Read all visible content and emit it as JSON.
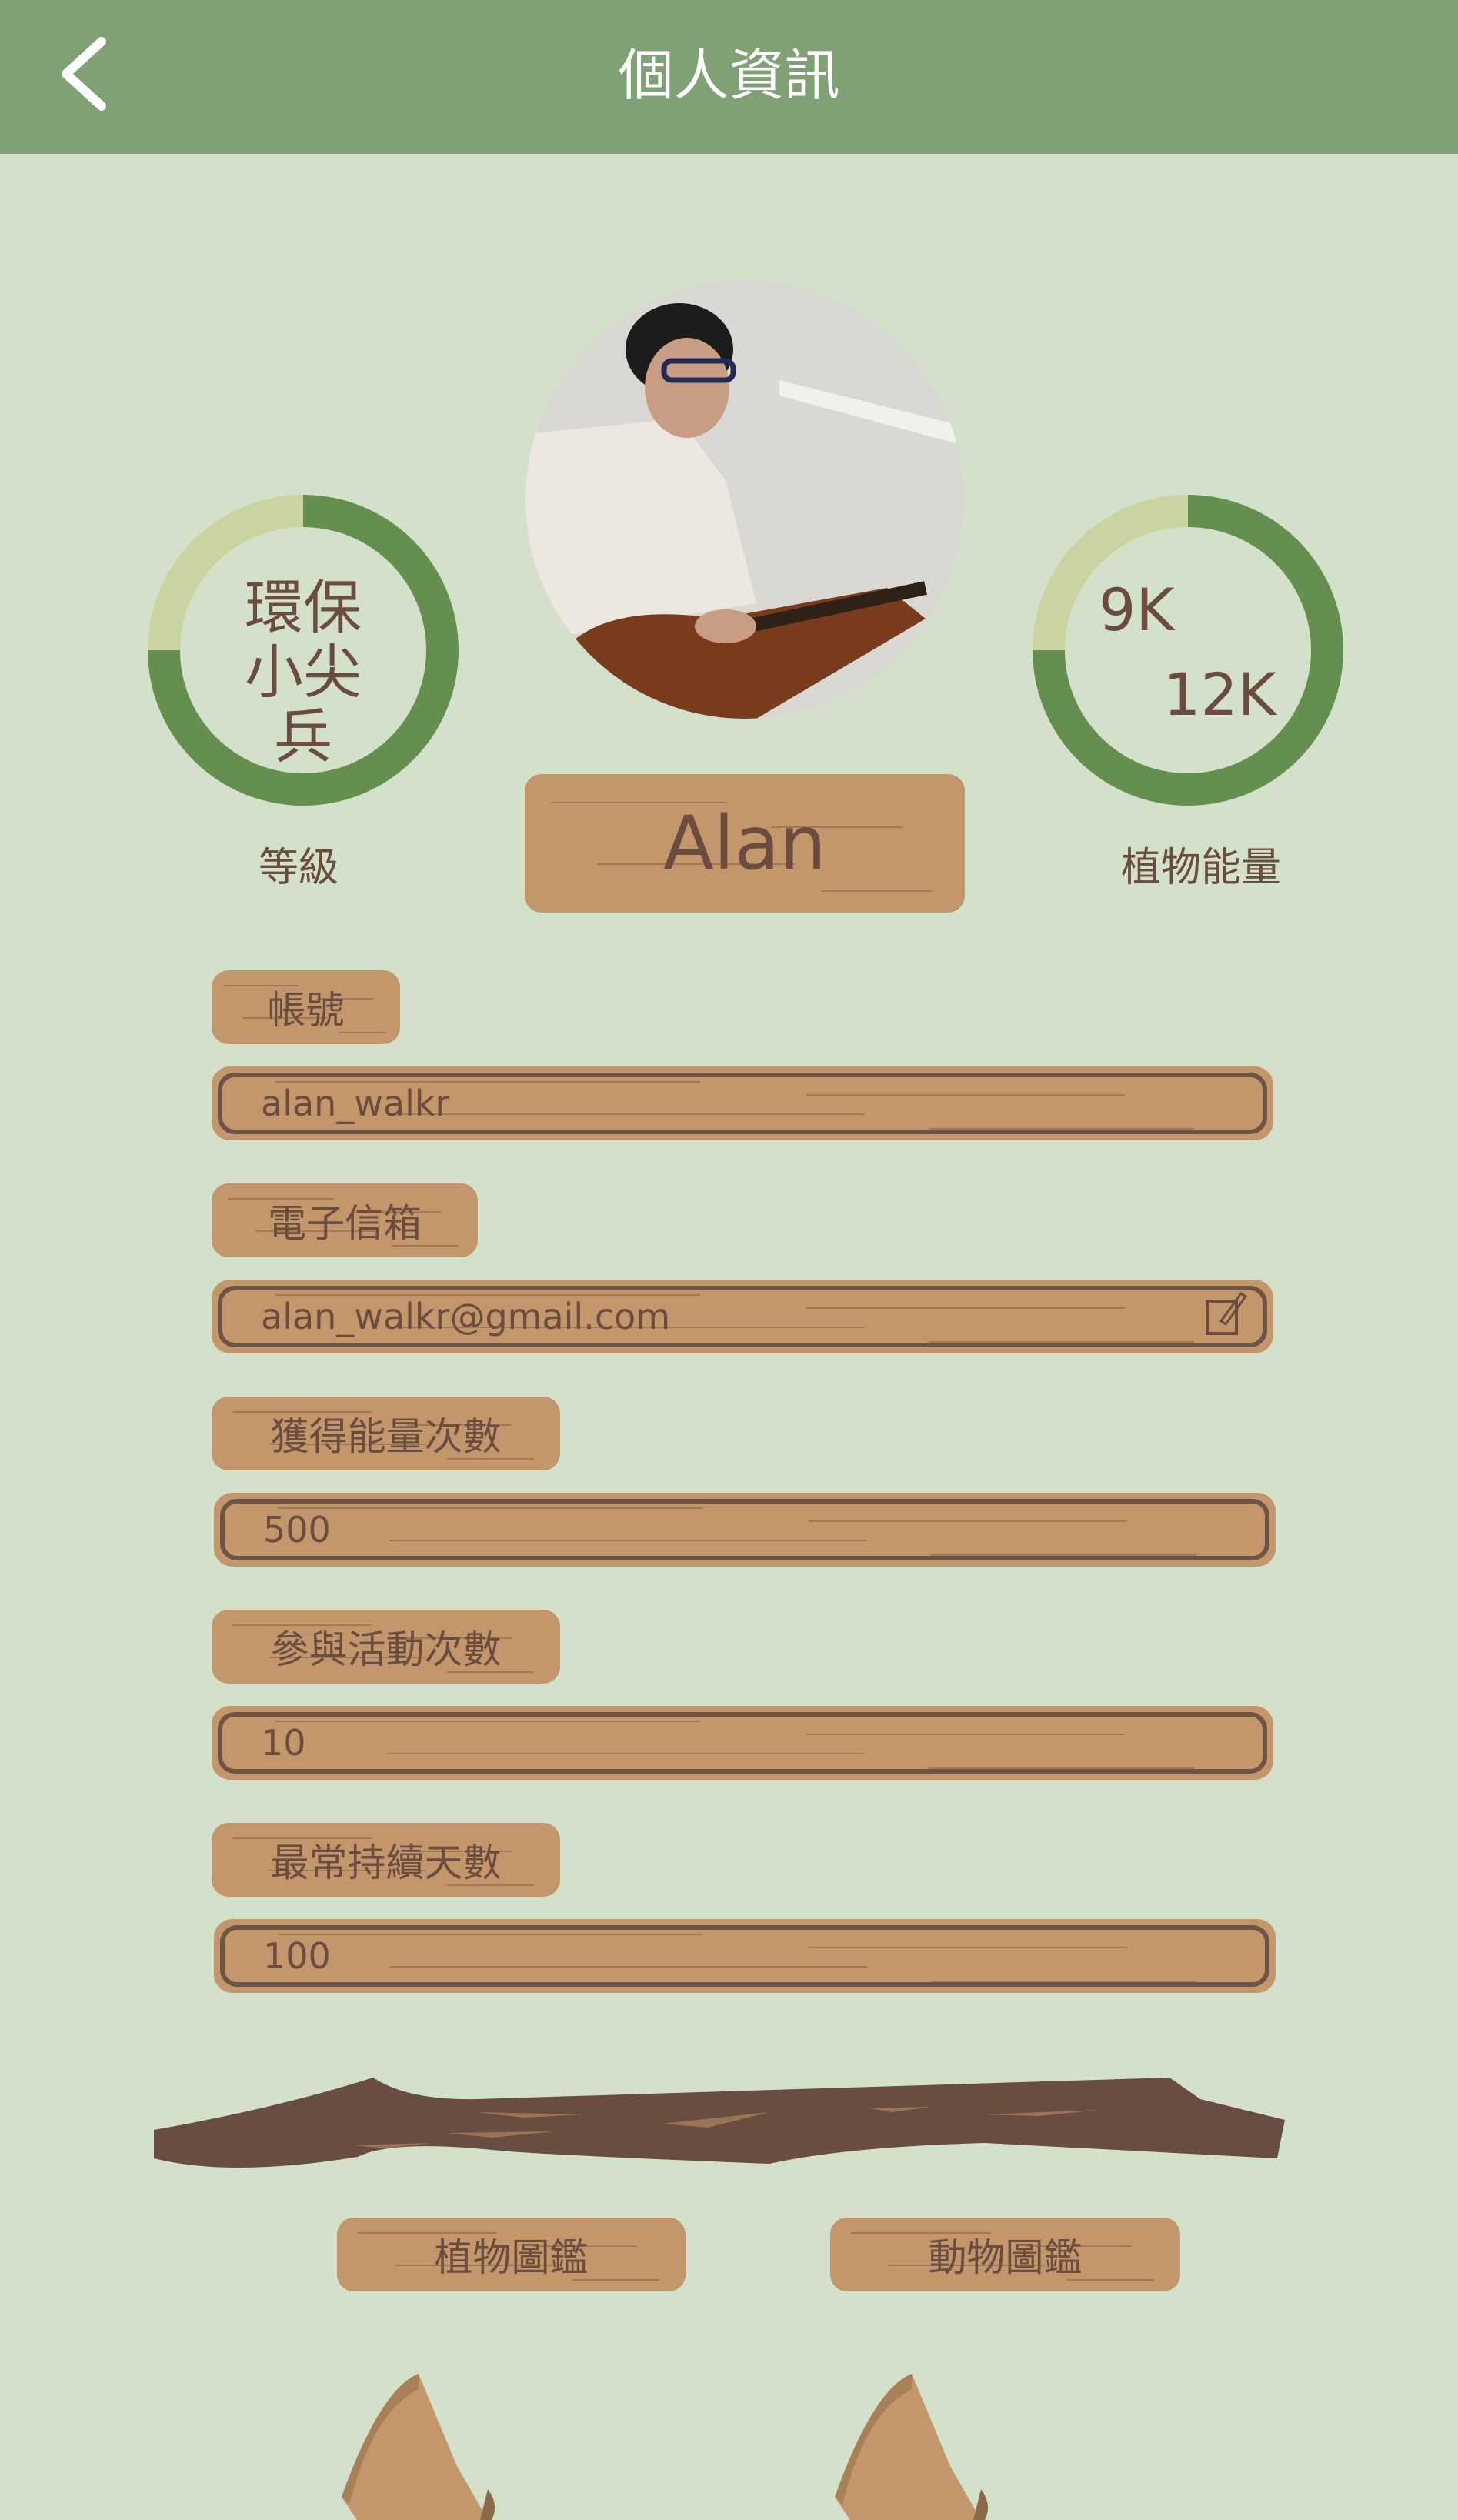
{
  "header": {
    "title": "個人資訊",
    "back_icon": "chevron-left-icon"
  },
  "profile": {
    "name": "Alan",
    "level": {
      "line1": "環保",
      "line2": "小尖兵",
      "label": "等級",
      "progress_percent": 75
    },
    "energy": {
      "current": "9K",
      "max": "12K",
      "label": "植物能量",
      "progress_percent": 75
    }
  },
  "fields": [
    {
      "label": "帳號",
      "value": "alan_walkr"
    },
    {
      "label": "電子信箱",
      "value": "alan_walkr@gmail.com",
      "icon": "edit-icon"
    },
    {
      "label": "獲得能量次數",
      "value": "500"
    },
    {
      "label": "參與活動次數",
      "value": "10"
    },
    {
      "label": "最常持續天數",
      "value": "100"
    }
  ],
  "buttons": {
    "plants": "植物圖鑑",
    "animals": "動物圖鑑"
  },
  "colors": {
    "header": "#80a076",
    "background": "#d3e0ca",
    "wood": "#c3976b",
    "text": "#6b4c3f",
    "ring": "#648f4e",
    "ring_track": "#c9d4a0"
  }
}
